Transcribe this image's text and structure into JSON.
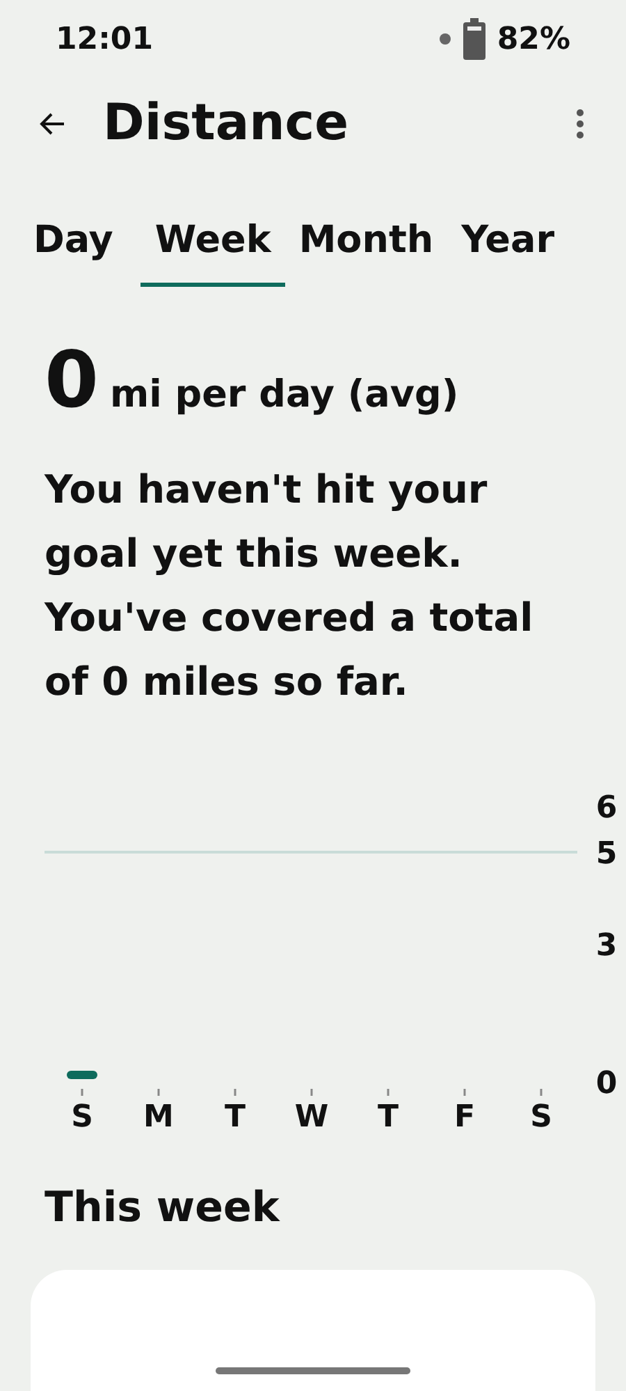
{
  "status_bar": {
    "time": "12:01",
    "battery": "82%"
  },
  "header": {
    "title": "Distance"
  },
  "tabs": [
    {
      "label": "Day",
      "selected": false
    },
    {
      "label": "Week",
      "selected": true
    },
    {
      "label": "Month",
      "selected": false
    },
    {
      "label": "Year",
      "selected": false
    }
  ],
  "summary": {
    "value": "0",
    "unit": "mi per day (avg)",
    "message": "You haven't hit your goal yet this week. You've covered a total of 0 miles so far."
  },
  "chart_data": {
    "type": "bar",
    "categories": [
      "S",
      "M",
      "T",
      "W",
      "T",
      "F",
      "S"
    ],
    "values": [
      0,
      null,
      null,
      null,
      null,
      null,
      null
    ],
    "ylim": [
      0,
      6
    ],
    "yticks": [
      0,
      3,
      5,
      6
    ],
    "ref_lines": [
      {
        "axis": "y",
        "value": 5
      }
    ]
  },
  "section": {
    "title": "This week"
  }
}
